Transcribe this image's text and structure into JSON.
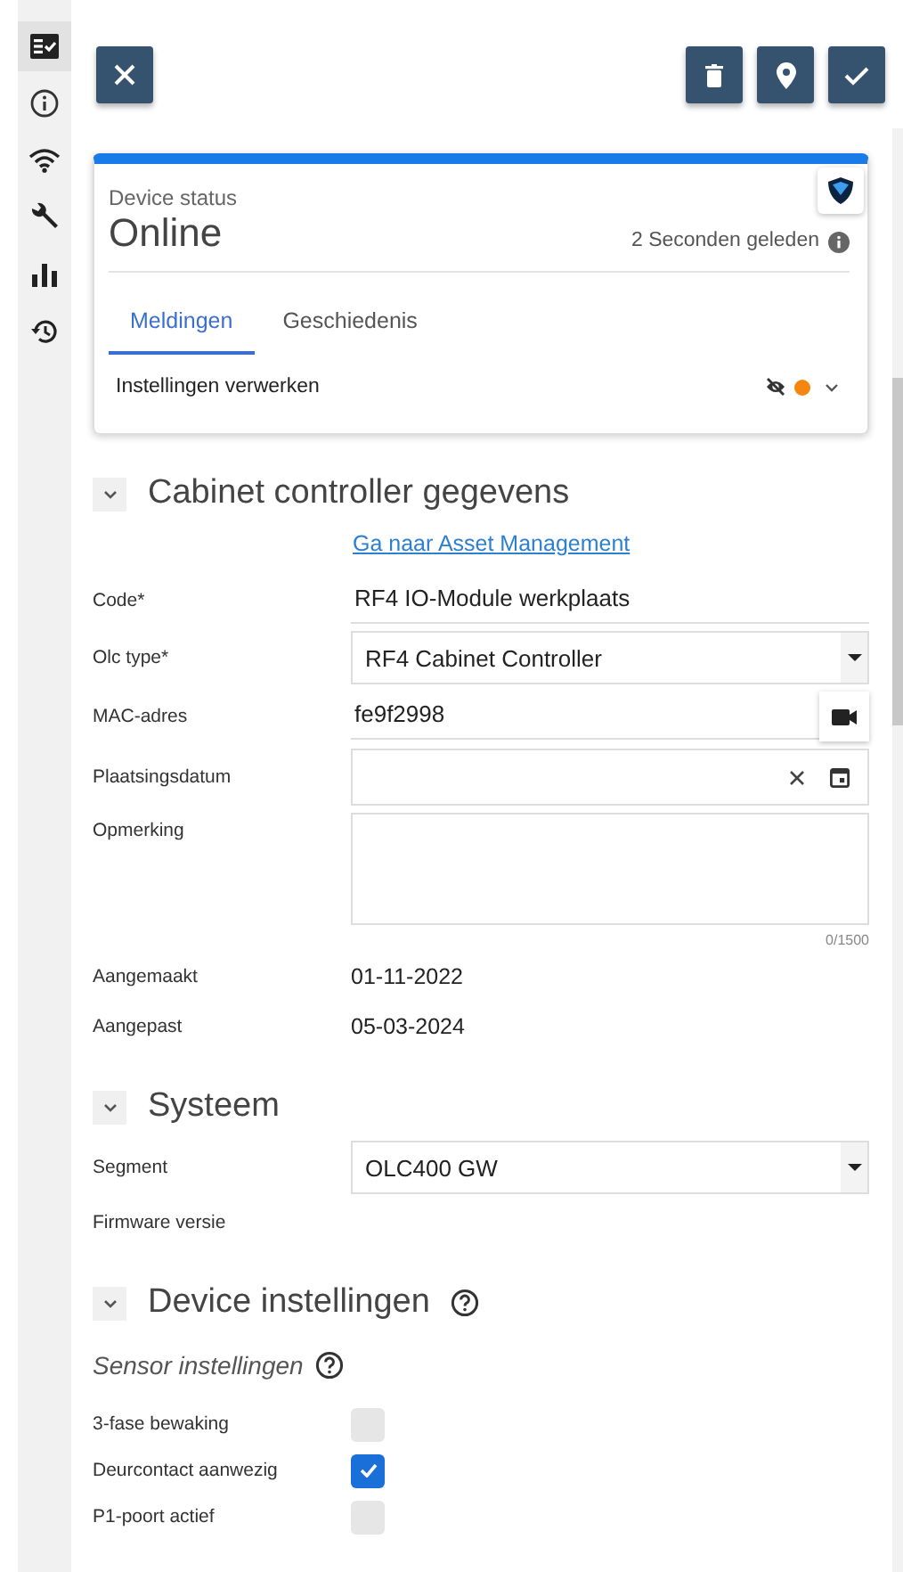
{
  "sidebar": {
    "items": [
      {
        "selected": true
      },
      {
        "selected": false
      },
      {
        "selected": false
      },
      {
        "selected": false
      },
      {
        "selected": false
      },
      {
        "selected": false
      }
    ]
  },
  "status_card": {
    "label": "Device status",
    "status": "Online",
    "updated": "2 Seconden geleden",
    "tabs": [
      {
        "label": "Meldingen",
        "selected": true
      },
      {
        "label": "Geschiedenis",
        "selected": false
      }
    ],
    "notifications": [
      {
        "text": "Instellingen verwerken",
        "color": "#f5870f",
        "expanded": false
      }
    ]
  },
  "sections": [
    {
      "title": "Cabinet controller gegevens",
      "expanded": true,
      "help": false,
      "link": "Ga naar Asset Management",
      "fields": [
        {
          "kind": "text",
          "label": "Code*",
          "value": "RF4 IO-Module werkplaats"
        },
        {
          "kind": "select",
          "label": "Olc type*",
          "value": "RF4 Cabinet Controller"
        },
        {
          "kind": "scan",
          "label": "MAC-adres",
          "value": "fe9f2998"
        },
        {
          "kind": "date",
          "label": "Plaatsingsdatum"
        },
        {
          "kind": "textarea",
          "label": "Opmerking",
          "counter": "0/1500"
        },
        {
          "kind": "readonly",
          "label": "Aangemaakt",
          "value": "01-11-2022"
        },
        {
          "kind": "readonly",
          "label": "Aangepast",
          "value": "05-03-2024"
        }
      ]
    },
    {
      "title": "Systeem",
      "expanded": true,
      "help": false,
      "fields": [
        {
          "kind": "select",
          "label": "Segment",
          "value": "OLC400 GW"
        },
        {
          "kind": "readonly",
          "label": "Firmware versie"
        }
      ]
    },
    {
      "title": "Device instellingen",
      "expanded": true,
      "help": true,
      "subtitle": "Sensor instellingen",
      "fields": [
        {
          "kind": "checkbox",
          "label": "3-fase bewaking",
          "checked": false
        },
        {
          "kind": "checkbox",
          "label": "Deurcontact aanwezig",
          "checked": true
        },
        {
          "kind": "checkbox",
          "label": "P1-poort actief",
          "checked": false
        }
      ]
    }
  ]
}
